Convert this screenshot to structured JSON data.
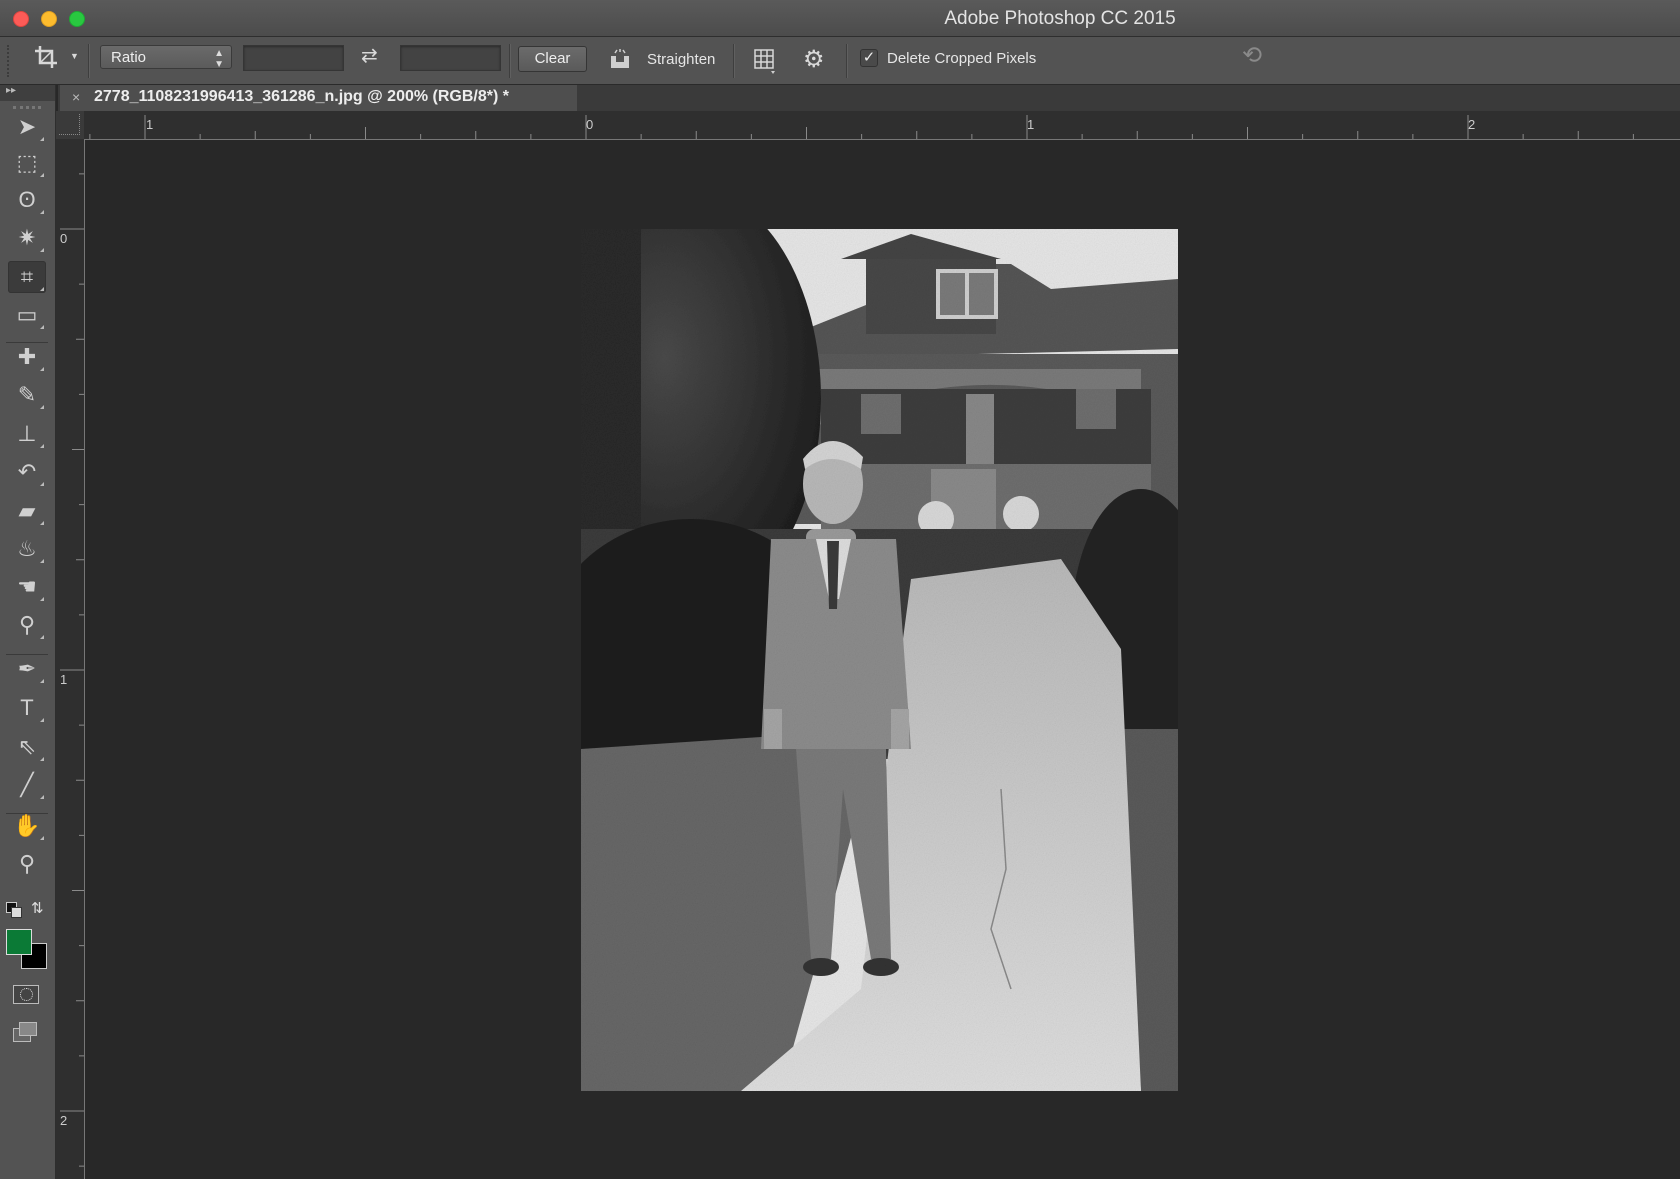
{
  "window": {
    "title": "Adobe Photoshop CC 2015",
    "traffic_lights": {
      "close": "#fc5b57",
      "minimize": "#fdbc2e",
      "zoom": "#29c840"
    }
  },
  "options_bar": {
    "tool_icon": "crop-icon",
    "ratio_select": {
      "value": "Ratio"
    },
    "width_field": {
      "value": ""
    },
    "swap_icon": "swap-arrows-icon",
    "height_field": {
      "value": ""
    },
    "clear_label": "Clear",
    "straighten_label": "Straighten",
    "overlay_icon": "grid-overlay-icon",
    "settings_icon": "gear-icon",
    "delete_cropped_pixels": {
      "label": "Delete Cropped Pixels",
      "checked": true
    },
    "reset_icon": "reset-icon"
  },
  "document_tab": {
    "close_glyph": "×",
    "name": "2778_1108231996413_361286_n.jpg @ 200% (RGB/8*) *"
  },
  "tools": [
    {
      "name": "move-tool",
      "glyph": "➤"
    },
    {
      "name": "marquee-tool",
      "glyph": "⬚"
    },
    {
      "name": "lasso-tool",
      "glyph": "ʘ"
    },
    {
      "name": "magic-wand-tool",
      "glyph": "✷"
    },
    {
      "name": "crop-tool",
      "glyph": "⌗",
      "active": true
    },
    {
      "name": "ruler-tool",
      "glyph": "▭"
    },
    {
      "name": "healing-brush-tool",
      "glyph": "✚"
    },
    {
      "name": "brush-tool",
      "glyph": "✎"
    },
    {
      "name": "clone-stamp-tool",
      "glyph": "⊥"
    },
    {
      "name": "history-brush-tool",
      "glyph": "↶"
    },
    {
      "name": "eraser-tool",
      "glyph": "▰"
    },
    {
      "name": "paint-bucket-tool",
      "glyph": "♨"
    },
    {
      "name": "smudge-tool",
      "glyph": "☚"
    },
    {
      "name": "dodge-tool",
      "glyph": "⚲"
    },
    {
      "name": "pen-tool",
      "glyph": "✒"
    },
    {
      "name": "type-tool",
      "glyph": "T"
    },
    {
      "name": "path-selection-tool",
      "glyph": "⇖"
    },
    {
      "name": "line-tool",
      "glyph": "╱"
    },
    {
      "name": "hand-tool",
      "glyph": "✋"
    },
    {
      "name": "zoom-tool",
      "glyph": "⚲"
    }
  ],
  "colors": {
    "foreground": "#0b7a36",
    "background": "#000000"
  },
  "rulers": {
    "horizontal_labels": [
      "1",
      "0",
      "1",
      "2"
    ],
    "vertical_labels": [
      "0",
      "1",
      "2"
    ]
  },
  "document": {
    "zoom_percent": 200,
    "color_mode": "RGB/8",
    "image_description": "Black-and-white vintage photo of a boy in a suit standing on a sidewalk in front of a bungalow house"
  }
}
